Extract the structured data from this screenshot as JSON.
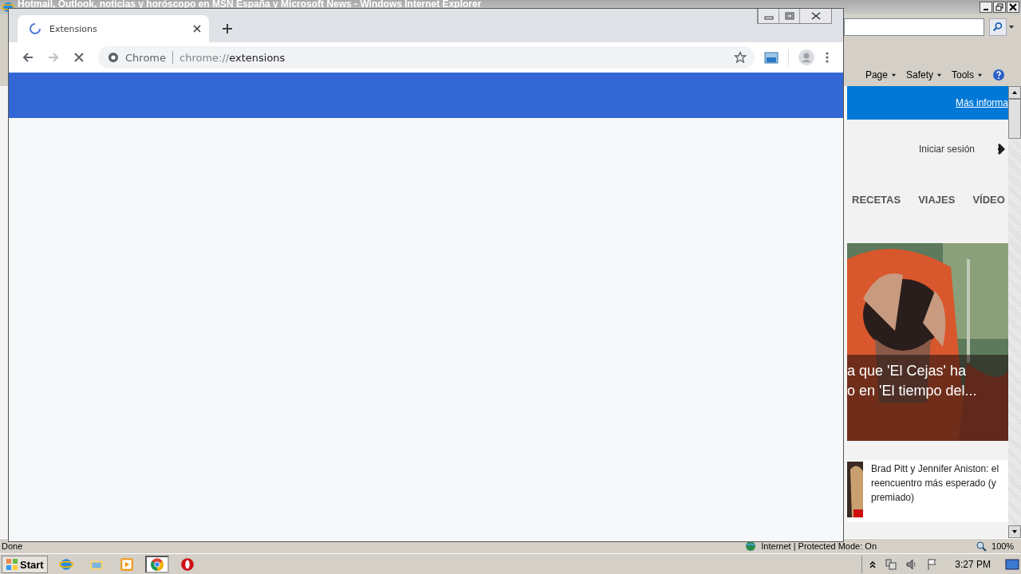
{
  "ie_window": {
    "title": "Hotmail, Outlook, noticias y horóscopo en MSN España y Microsoft News - Windows Internet Explorer",
    "command_bar": [
      "Page",
      "Safety",
      "Tools"
    ],
    "banner_link": "Más informa",
    "sign_in": "Iniciar sesión",
    "nav": [
      "RECETAS",
      "VIAJES",
      "VÍDEO"
    ],
    "hero": {
      "caption_lines": [
        "a que 'El Cejas' ha",
        "o en 'El tiempo del..."
      ]
    },
    "news": [
      {
        "title": "Brad Pitt y Jennifer Aniston: el reencuentro más esperado (y premiado)"
      }
    ],
    "status_bar": {
      "text": "Done",
      "zone": "Internet | Protected Mode: On",
      "zoom": "100%"
    }
  },
  "chrome_window": {
    "tabs": [
      {
        "title": "Extensions",
        "selected": true,
        "loading": true
      }
    ],
    "omnibox": {
      "site": "Chrome",
      "url_scheme": "chrome://",
      "url_path": "extensions"
    }
  },
  "taskbar": {
    "start": "Start",
    "apps": [
      {
        "kind": "ie",
        "selected": false
      },
      {
        "kind": "folder",
        "selected": false
      },
      {
        "kind": "media",
        "selected": false
      },
      {
        "kind": "chrome",
        "selected": true
      },
      {
        "kind": "opera",
        "selected": false
      }
    ],
    "clock": "3:27 PM"
  }
}
